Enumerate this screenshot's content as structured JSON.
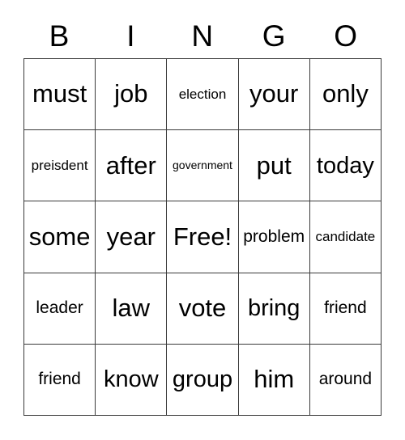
{
  "card": {
    "header_letters": [
      "B",
      "I",
      "N",
      "G",
      "O"
    ],
    "rows": [
      [
        {
          "text": "must",
          "size": "xl"
        },
        {
          "text": "job",
          "size": "xl"
        },
        {
          "text": "election",
          "size": "sm"
        },
        {
          "text": "your",
          "size": "xl"
        },
        {
          "text": "only",
          "size": "xl"
        }
      ],
      [
        {
          "text": "preisdent",
          "size": "sm"
        },
        {
          "text": "after",
          "size": "xl"
        },
        {
          "text": "government",
          "size": "xs"
        },
        {
          "text": "put",
          "size": "xl"
        },
        {
          "text": "today",
          "size": "lg"
        }
      ],
      [
        {
          "text": "some",
          "size": "xl"
        },
        {
          "text": "year",
          "size": "xl"
        },
        {
          "text": "Free!",
          "size": "xl"
        },
        {
          "text": "problem",
          "size": "md"
        },
        {
          "text": "candidate",
          "size": "sm"
        }
      ],
      [
        {
          "text": "leader",
          "size": "md"
        },
        {
          "text": "law",
          "size": "xl"
        },
        {
          "text": "vote",
          "size": "xl"
        },
        {
          "text": "bring",
          "size": "lg"
        },
        {
          "text": "friend",
          "size": "md"
        }
      ],
      [
        {
          "text": "friend",
          "size": "md"
        },
        {
          "text": "know",
          "size": "lg"
        },
        {
          "text": "group",
          "size": "lg"
        },
        {
          "text": "him",
          "size": "xl"
        },
        {
          "text": "around",
          "size": "md"
        }
      ]
    ]
  }
}
